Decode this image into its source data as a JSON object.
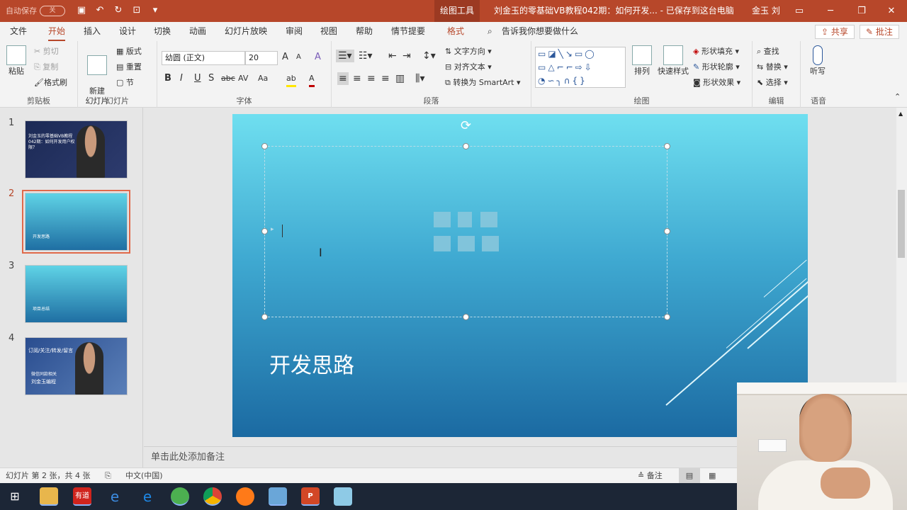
{
  "titlebar": {
    "autosave_label": "自动保存",
    "autosave_state": "关",
    "context_tab": "绘图工具",
    "title": "刘金玉的零基础VB教程042期：如何开发...  -  已保存到这台电脑",
    "user": "金玉 刘",
    "qat_icons": [
      "save-icon",
      "undo-icon",
      "redo-icon",
      "present-icon",
      "customize-icon"
    ]
  },
  "tabs": {
    "items": [
      "文件",
      "开始",
      "插入",
      "设计",
      "切换",
      "动画",
      "幻灯片放映",
      "审阅",
      "视图",
      "帮助",
      "情节提要",
      "格式"
    ],
    "active": "开始",
    "search": "告诉我你想要做什么",
    "share": "共享",
    "comment": "批注"
  },
  "ribbon": {
    "clipboard": {
      "label": "剪贴板",
      "paste": "粘贴",
      "cut": "剪切",
      "copy": "复制",
      "format_painter": "格式刷"
    },
    "slides": {
      "label": "幻灯片",
      "new_slide": "新建\n幻灯片",
      "layout": "版式",
      "reset": "重置",
      "section": "节"
    },
    "font": {
      "label": "字体",
      "name": "幼圆 (正文)",
      "size": "20",
      "bold": "B",
      "italic": "I",
      "underline": "U",
      "shadow": "S",
      "strike": "abc",
      "spacing": "AV",
      "case": "Aa",
      "grow": "A",
      "shrink": "A",
      "clear": "A",
      "highlight": "ab",
      "color": "A"
    },
    "paragraph": {
      "label": "段落",
      "direction": "文字方向",
      "align": "对齐文本",
      "smartart": "转换为 SmartArt"
    },
    "drawing": {
      "label": "绘图",
      "arrange": "排列",
      "quick_styles": "快速样式",
      "fill": "形状填充",
      "outline": "形状轮廓",
      "effects": "形状效果"
    },
    "editing": {
      "label": "编辑",
      "find": "查找",
      "replace": "替换",
      "select": "选择"
    },
    "voice": {
      "label": "语音",
      "dictate": "听写"
    }
  },
  "slides_panel": {
    "slides": [
      {
        "num": "1",
        "text": "刘金玉的零基础VB教程042期：如何开发用户权限？"
      },
      {
        "num": "2",
        "text": "开发思路"
      },
      {
        "num": "3",
        "text": "项目总结"
      },
      {
        "num": "4",
        "text": "订阅/关注/转发/留言",
        "sub": "微信同款相关",
        "author": "刘金玉编程"
      }
    ],
    "selected": 2
  },
  "slide": {
    "title": "开发思路"
  },
  "notes": {
    "placeholder": "单击此处添加备注"
  },
  "status": {
    "slide_info": "幻灯片 第 2 张，共 4 张",
    "language": "中文(中国)",
    "notes_btn": "备注"
  },
  "taskbar": {
    "apps": [
      "start-icon",
      "file-explorer-icon",
      "youdao-icon",
      "edge-icon",
      "wechat-icon",
      "chrome-icon",
      "firefox-icon",
      "remote-desktop-icon",
      "powerpoint-icon",
      "vb-icon"
    ],
    "youdao_label": "有道"
  },
  "colors": {
    "accent": "#b7472a",
    "slide_top": "#6fdff0",
    "slide_bottom": "#1b6aa2"
  }
}
